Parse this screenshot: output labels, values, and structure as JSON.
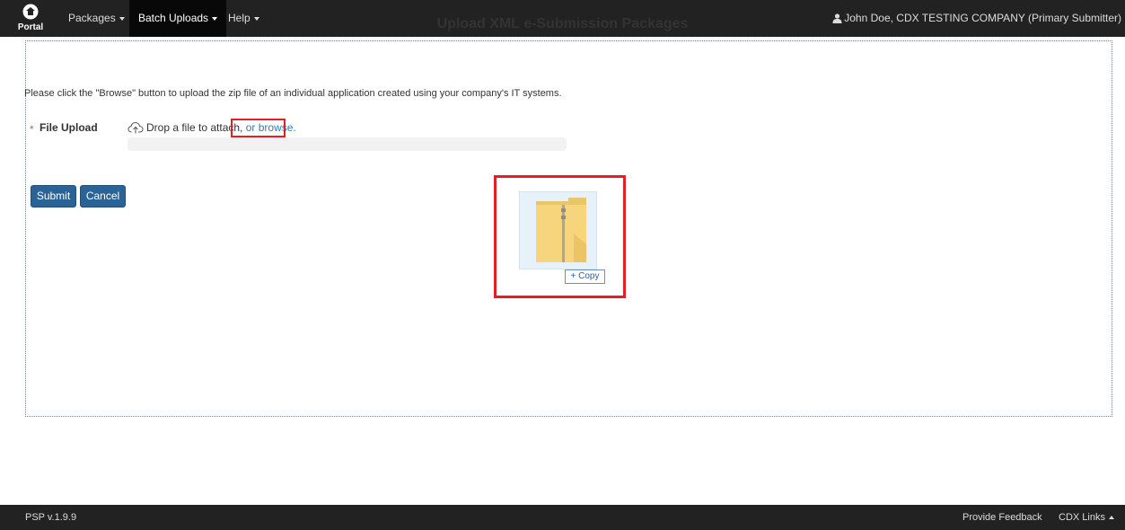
{
  "navbar": {
    "brand_label": "Portal",
    "items": [
      {
        "label": "Packages",
        "active": false
      },
      {
        "label": "Batch Uploads",
        "active": true
      },
      {
        "label": "Help",
        "active": false
      }
    ],
    "user_label": "John Doe, CDX TESTING COMPANY (Primary Submitter)"
  },
  "main": {
    "title": "Upload XML e-Submission Packages",
    "instructions": "Please click the \"Browse\" button to upload the zip file of an individual application created using your company's IT systems.",
    "file_upload": {
      "required_mark": "*",
      "label": "File Upload",
      "drop_text": "Drop a file to attach, ",
      "browse_text": "or browse."
    },
    "buttons": {
      "submit": "Submit",
      "cancel": "Cancel"
    },
    "drag_overlay": {
      "copy_label": "+ Copy"
    }
  },
  "footer": {
    "version": "PSP  v.1.9.9",
    "feedback": "Provide Feedback",
    "cdx_links": "CDX Links"
  },
  "colors": {
    "navbar_bg": "#222222",
    "active_nav_bg": "#080808",
    "button_bg": "#2a6496",
    "highlight": "#e31e24",
    "container_border": "#2aa788",
    "link": "#337ab7"
  }
}
